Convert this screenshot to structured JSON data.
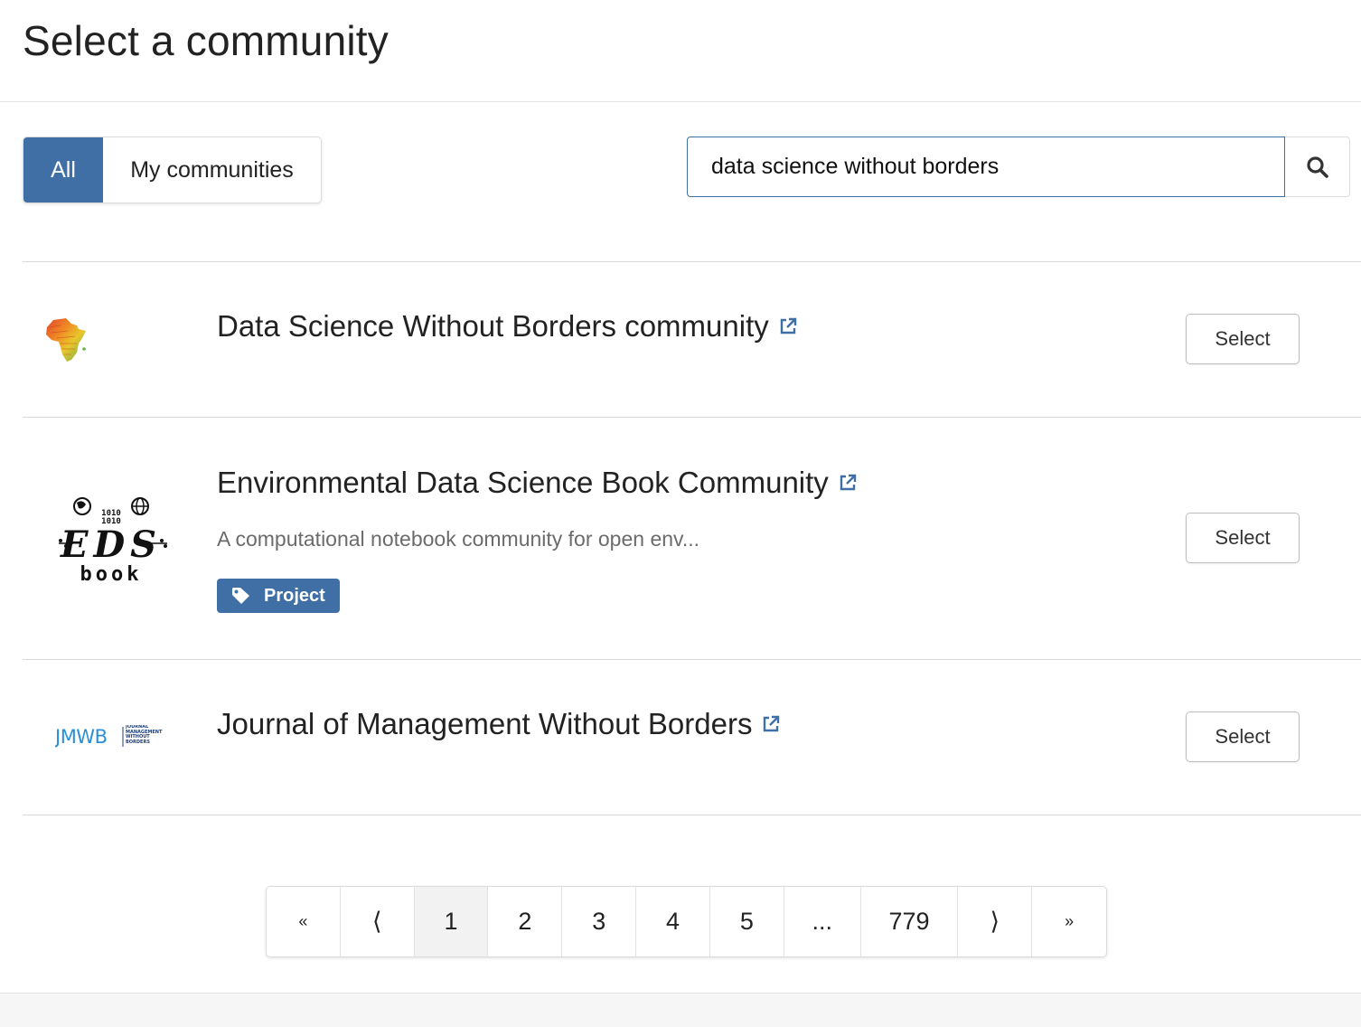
{
  "header": {
    "title": "Select a community"
  },
  "tabs": [
    {
      "label": "All",
      "active": true
    },
    {
      "label": "My communities",
      "active": false
    }
  ],
  "search": {
    "value": "data science without borders",
    "icon": "search-icon"
  },
  "communities": [
    {
      "title": "Data Science Without Borders community",
      "description": "",
      "tag": "",
      "logo": "africa-map-logo",
      "select_label": "Select"
    },
    {
      "title": "Environmental Data Science Book Community",
      "description": "A computational notebook community for open env...",
      "tag": "Project",
      "logo": "eds-book-logo",
      "logo_text": {
        "top": "1010",
        "bottom": "1010",
        "main": "EDS",
        "sub": "book"
      },
      "select_label": "Select"
    },
    {
      "title": "Journal of Management Without Borders",
      "description": "",
      "tag": "",
      "logo": "jmwb-logo",
      "logo_text": {
        "main": "JMWB",
        "sub": "JOURNAL MANAGEMENT WITHOUT BORDERS"
      },
      "select_label": "Select"
    }
  ],
  "pagination": {
    "first": "«",
    "prev": "⟨",
    "pages": [
      "1",
      "2",
      "3",
      "4",
      "5"
    ],
    "ellipsis": "...",
    "last_page": "779",
    "next": "⟩",
    "last": "»",
    "current": "1"
  },
  "colors": {
    "accent": "#3f6fa4",
    "divider": "#dadada"
  }
}
